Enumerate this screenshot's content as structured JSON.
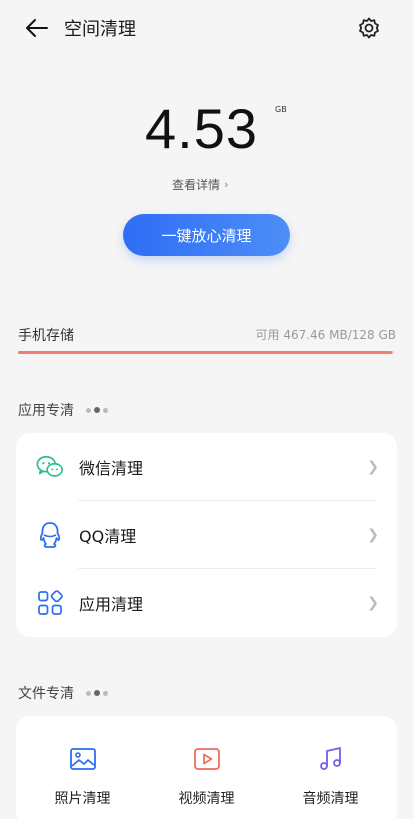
{
  "header": {
    "title": "空间清理",
    "back_icon": "back-arrow-icon",
    "settings_icon": "gear-icon"
  },
  "summary": {
    "size": "4.53",
    "unit": "GB",
    "detail_link": "查看详情"
  },
  "actions": {
    "one_click_clean": "一键放心清理"
  },
  "storage": {
    "label": "手机存储",
    "value": "可用 467.46 MB/128 GB",
    "used_fraction": 0.996,
    "fill_color": "#f07f73"
  },
  "app_section": {
    "title": "应用专清",
    "items": [
      {
        "label": "微信清理",
        "icon": "wechat-icon"
      },
      {
        "label": "QQ清理",
        "icon": "qq-icon"
      },
      {
        "label": "应用清理",
        "icon": "apps-grid-icon"
      }
    ]
  },
  "file_section": {
    "title": "文件专清",
    "items": [
      {
        "label": "照片清理",
        "icon": "photo-icon"
      },
      {
        "label": "视频清理",
        "icon": "video-icon"
      },
      {
        "label": "音频清理",
        "icon": "music-note-icon"
      }
    ]
  },
  "colors": {
    "accent_blue": "#2f6df5",
    "wechat_green": "#2bbf88",
    "qq_blue": "#2a6ff0",
    "video_red": "#ef6b5d",
    "audio_purple": "#7a5ce6"
  }
}
